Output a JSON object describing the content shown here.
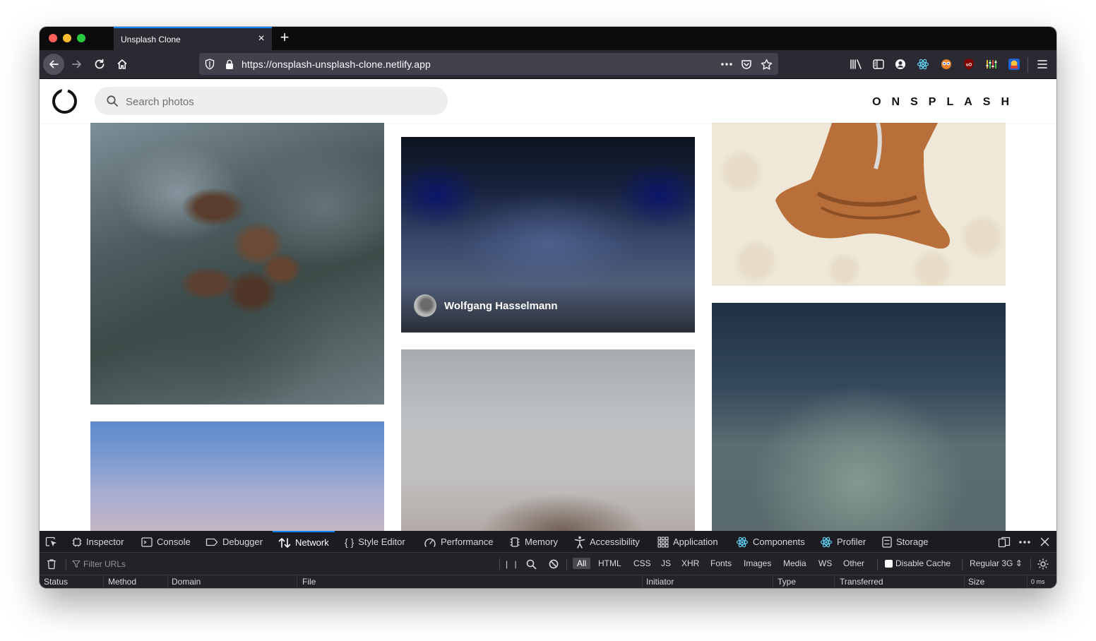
{
  "browser": {
    "tab_title": "Unsplash Clone",
    "url": "https://onsplash-unsplash-clone.netlify.app"
  },
  "page": {
    "search_placeholder": "Search photos",
    "brand": "ONSPLASH",
    "photo_credit": "Wolfgang Hasselmann"
  },
  "devtools": {
    "tabs": [
      "Inspector",
      "Console",
      "Debugger",
      "Network",
      "Style Editor",
      "Performance",
      "Memory",
      "Accessibility",
      "Application",
      "Components",
      "Profiler",
      "Storage"
    ],
    "active_tab": "Network",
    "filter_placeholder": "Filter URLs",
    "type_filters": [
      "All",
      "HTML",
      "CSS",
      "JS",
      "XHR",
      "Fonts",
      "Images",
      "Media",
      "WS",
      "Other"
    ],
    "active_filter": "All",
    "disable_cache_label": "Disable Cache",
    "throttle": "Regular 3G",
    "columns": [
      "Status",
      "Method",
      "Domain",
      "File",
      "Initiator",
      "Type",
      "Transferred",
      "Size"
    ],
    "timing_label": "0 ms"
  },
  "colors": {
    "accent": "#0a84ff",
    "tab_strip": "#0c0c0d",
    "toolbar": "#2b2a33",
    "devtools_bg": "#232327"
  }
}
